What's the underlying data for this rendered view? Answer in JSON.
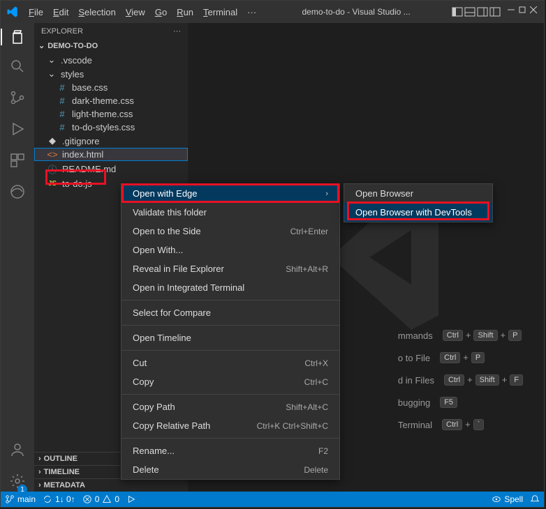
{
  "titlebar": {
    "menus": [
      "File",
      "Edit",
      "Selection",
      "View",
      "Go",
      "Run",
      "Terminal",
      "..."
    ],
    "title": "demo-to-do - Visual Studio ..."
  },
  "sidebar": {
    "header": "EXPLORER",
    "more": "...",
    "project": "DEMO-TO-DO",
    "tree": {
      "vscode_folder": ".vscode",
      "styles_folder": "styles",
      "base_css": "base.css",
      "dark_theme": "dark-theme.css",
      "light_theme": "light-theme.css",
      "todo_styles": "to-do-styles.css",
      "gitignore": ".gitignore",
      "index_html": "index.html",
      "readme": "README.md",
      "todo_js": "to-do.js"
    },
    "outline": "OUTLINE",
    "timeline": "TIMELINE",
    "metadata": "METADATA"
  },
  "context_menu": {
    "open_with_edge": "Open with Edge",
    "validate": "Validate this folder",
    "open_side": "Open to the Side",
    "open_side_key": "Ctrl+Enter",
    "open_with": "Open With...",
    "reveal": "Reveal in File Explorer",
    "reveal_key": "Shift+Alt+R",
    "integrated_terminal": "Open in Integrated Terminal",
    "select_compare": "Select for Compare",
    "open_timeline": "Open Timeline",
    "cut": "Cut",
    "cut_key": "Ctrl+X",
    "copy": "Copy",
    "copy_key": "Ctrl+C",
    "copy_path": "Copy Path",
    "copy_path_key": "Shift+Alt+C",
    "copy_rel": "Copy Relative Path",
    "copy_rel_key": "Ctrl+K Ctrl+Shift+C",
    "rename": "Rename...",
    "rename_key": "F2",
    "delete": "Delete",
    "delete_key": "Delete"
  },
  "submenu": {
    "open_browser": "Open Browser",
    "open_browser_devtools": "Open Browser with DevTools"
  },
  "welcome": {
    "commands_label": "mmands",
    "commands_keys": [
      "Ctrl",
      "+",
      "Shift",
      "+",
      "P"
    ],
    "file_label": "o to File",
    "file_keys": [
      "Ctrl",
      "+",
      "P"
    ],
    "find_label": "d in Files",
    "find_keys": [
      "Ctrl",
      "+",
      "Shift",
      "+",
      "F"
    ],
    "debug_label": "bugging",
    "debug_keys": [
      "F5"
    ],
    "terminal_label": "Terminal",
    "terminal_keys": [
      "Ctrl",
      "+",
      "`"
    ]
  },
  "statusbar": {
    "branch": "main",
    "sync": "1↓ 0↑",
    "errors": "0",
    "warnings": "0",
    "spell": "Spell"
  }
}
